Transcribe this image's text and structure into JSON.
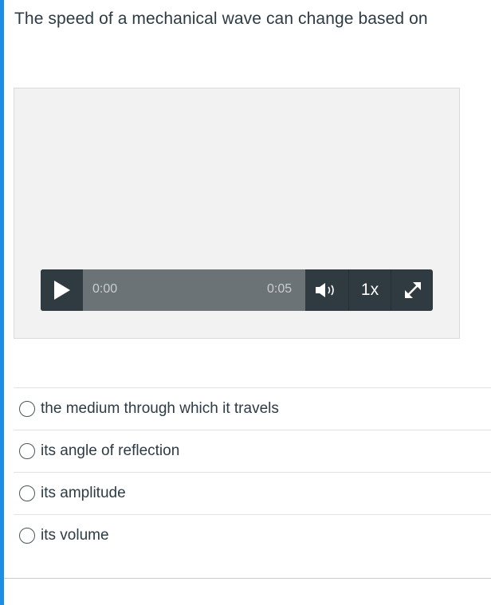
{
  "question": {
    "text": "The speed of a mechanical wave can change based on"
  },
  "player": {
    "current_time": "0:00",
    "total_time": "0:05",
    "speed": "1x",
    "progress_fraction": 0,
    "icons": {
      "play": "play-icon",
      "volume": "volume-icon",
      "fullscreen": "fullscreen-icon"
    }
  },
  "answers": [
    {
      "label": "the medium through which it travels"
    },
    {
      "label": "its angle of reflection"
    },
    {
      "label": "its amplitude"
    },
    {
      "label": "its volume"
    }
  ],
  "colors": {
    "accent_bar": "#1a8fe3",
    "player_bg": "#2f3b40",
    "progress_track": "#6b7376",
    "text": "#2d3b45"
  }
}
